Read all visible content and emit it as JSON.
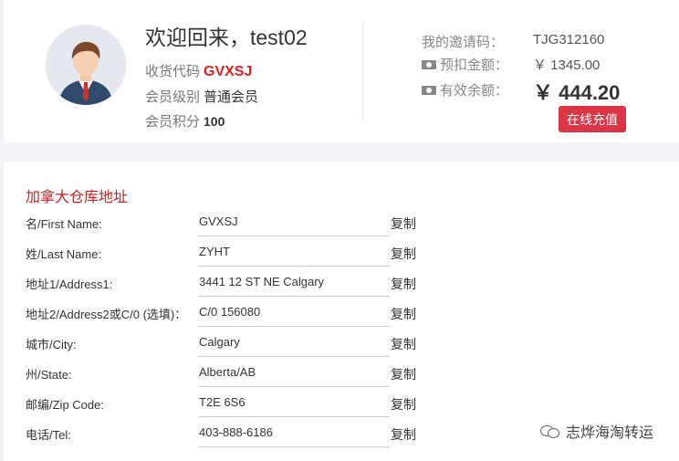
{
  "profile": {
    "greeting": "欢迎回来，test02",
    "code_label": "收货代码",
    "code_value": "GVXSJ",
    "level_label": "会员级别",
    "level_value": "普通会员",
    "points_label": "会员积分",
    "points_value": "100"
  },
  "account": {
    "invite_label": "我的邀请码：",
    "invite_value": "TJG312160",
    "withheld_label": "预扣金额：",
    "withheld_value": "￥ 1345.00",
    "balance_label": "有效余额：",
    "balance_value": "￥ 444.20",
    "recharge_label": "在线充值"
  },
  "warehouse": {
    "title": "加拿大仓库地址",
    "copy_label": "复制",
    "rows": [
      {
        "label": "名/First Name:",
        "value": "GVXSJ"
      },
      {
        "label": "姓/Last Name:",
        "value": "ZYHT"
      },
      {
        "label": "地址1/Address1:",
        "value": "3441 12 ST NE Calgary"
      },
      {
        "label": "地址2/Address2或C/0 (选填)：",
        "value": "C/0 156080"
      },
      {
        "label": "城市/City:",
        "value": "Calgary"
      },
      {
        "label": "州/State:",
        "value": "Alberta/AB"
      },
      {
        "label": "邮编/Zip Code:",
        "value": "T2E 6S6"
      },
      {
        "label": "电话/Tel:",
        "value": "403-888-6186"
      }
    ]
  },
  "watermark": {
    "text": "志烨海淘转运"
  }
}
